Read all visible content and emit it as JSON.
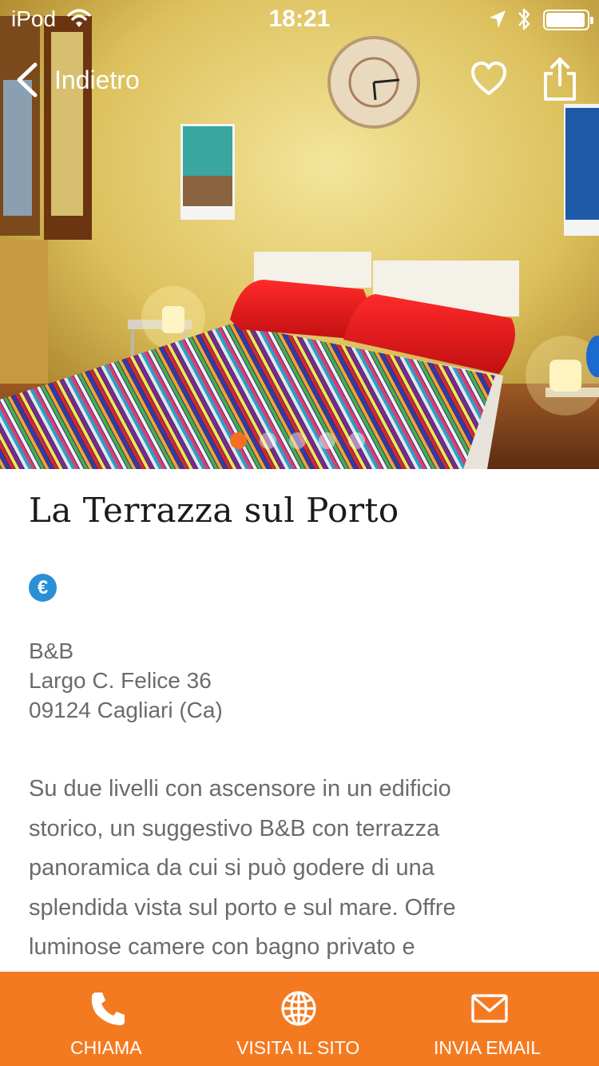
{
  "status_bar": {
    "carrier": "iPod",
    "time": "18:21",
    "icons": [
      "wifi-icon",
      "location-arrow-icon",
      "bluetooth-icon",
      "battery-icon"
    ]
  },
  "nav": {
    "back_label": "Indietro",
    "favorite_icon": "heart-outline-icon",
    "share_icon": "share-icon"
  },
  "gallery": {
    "page_count": 5,
    "current_page": 1,
    "active_dot_color": "#f47020"
  },
  "listing": {
    "title": "La Terrazza sul Porto",
    "price_badge": "€",
    "category": "B&B",
    "street": "Largo C. Felice 36",
    "city": "09124 Cagliari (Ca)",
    "description_lines": [
      "Su due livelli con ascensore in un edificio",
      "storico, un suggestivo B&B con terrazza",
      "panoramica da cui si può godere di una",
      "splendida vista sul porto e sul mare. Offre",
      "luminose camere con bagno privato e"
    ]
  },
  "actions": {
    "background_color": "#f47a21",
    "call_label": "CHIAMA",
    "site_label": "VISITA IL SITO",
    "email_label": "INVIA EMAIL"
  }
}
